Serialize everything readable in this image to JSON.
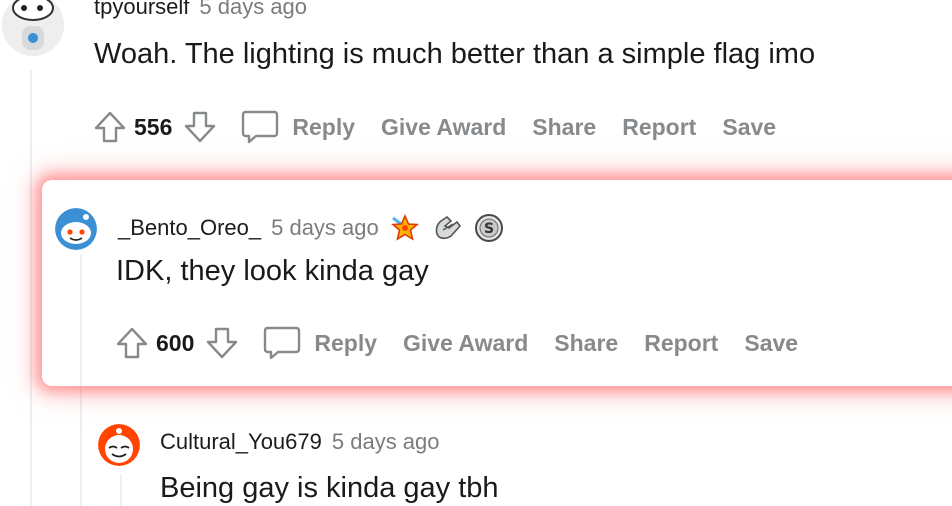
{
  "comments": [
    {
      "username": "tpyourself",
      "timestamp": "5 days ago",
      "body": "Woah. The lighting is much better than a simple flag imo",
      "score": "556"
    },
    {
      "username": "_Bento_Oreo_",
      "timestamp": "5 days ago",
      "body": "IDK, they look kinda gay",
      "score": "600",
      "awards": [
        "starstruck-award-icon",
        "wholesome-hands-award-icon",
        "silver-coin-award-icon"
      ],
      "highlighted": true
    },
    {
      "username": "Cultural_You679",
      "timestamp": "5 days ago",
      "body": "Being gay is kinda gay tbh"
    }
  ],
  "actions": {
    "reply": "Reply",
    "give_award": "Give Award",
    "share": "Share",
    "report": "Report",
    "save": "Save"
  },
  "colors": {
    "highlight_glow": "#ff5a5a",
    "muted_text": "#878a8c",
    "avatar_blue": "#3b8fd4",
    "avatar_orange": "#ff4500"
  }
}
